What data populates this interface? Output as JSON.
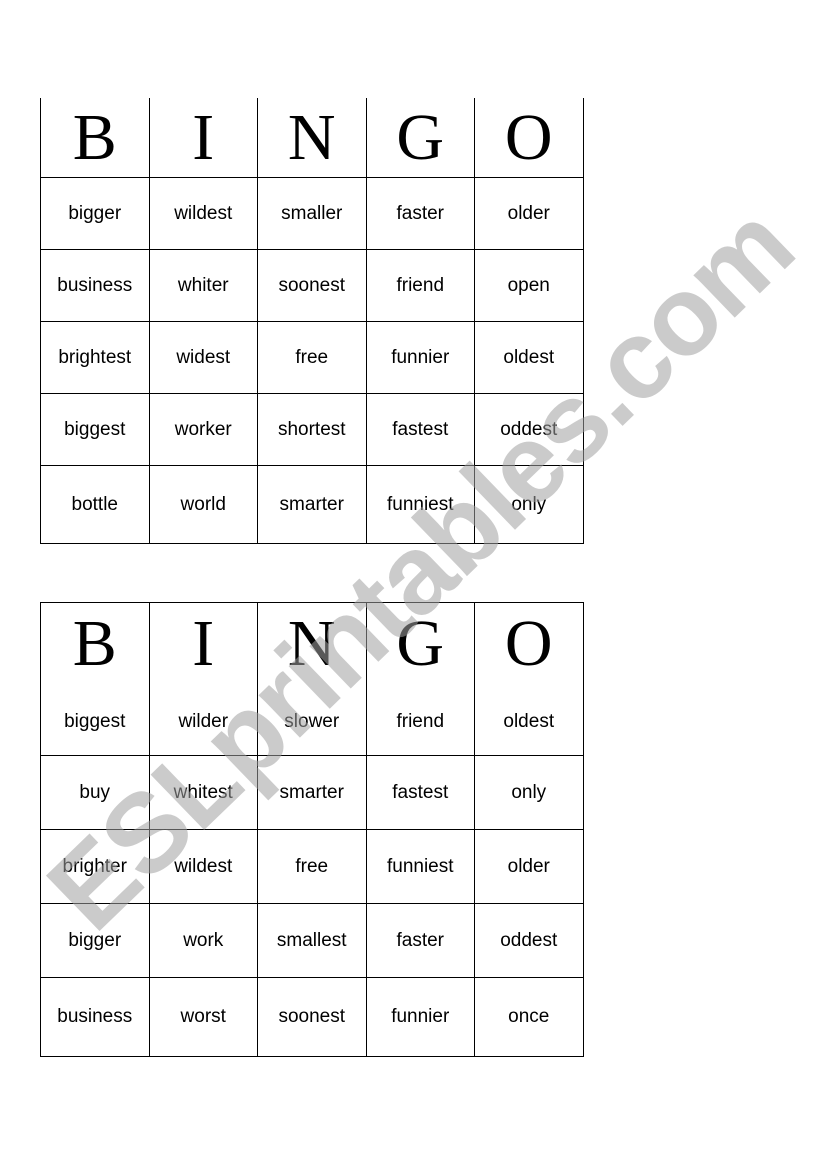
{
  "watermark": "ESLprintables.com",
  "cards": [
    {
      "header": [
        "B",
        "I",
        "N",
        "G",
        "O"
      ],
      "rows": [
        [
          "bigger",
          "wildest",
          "smaller",
          "faster",
          "older"
        ],
        [
          "business",
          "whiter",
          "soonest",
          "friend",
          "open"
        ],
        [
          "brightest",
          "widest",
          "free",
          "funnier",
          "oldest"
        ],
        [
          "biggest",
          "worker",
          "shortest",
          "fastest",
          "oddest"
        ],
        [
          "bottle",
          "world",
          "smarter",
          "funniest",
          "only"
        ]
      ]
    },
    {
      "header": [
        "B",
        "I",
        "N",
        "G",
        "O"
      ],
      "rows": [
        [
          "biggest",
          "wilder",
          "slower",
          "friend",
          "oldest"
        ],
        [
          "buy",
          "whitest",
          "smarter",
          "fastest",
          "only"
        ],
        [
          "brighter",
          "wildest",
          "free",
          "funniest",
          "older"
        ],
        [
          "bigger",
          "work",
          "smallest",
          "faster",
          "oddest"
        ],
        [
          "business",
          "worst",
          "soonest",
          "funnier",
          "once"
        ]
      ]
    }
  ]
}
